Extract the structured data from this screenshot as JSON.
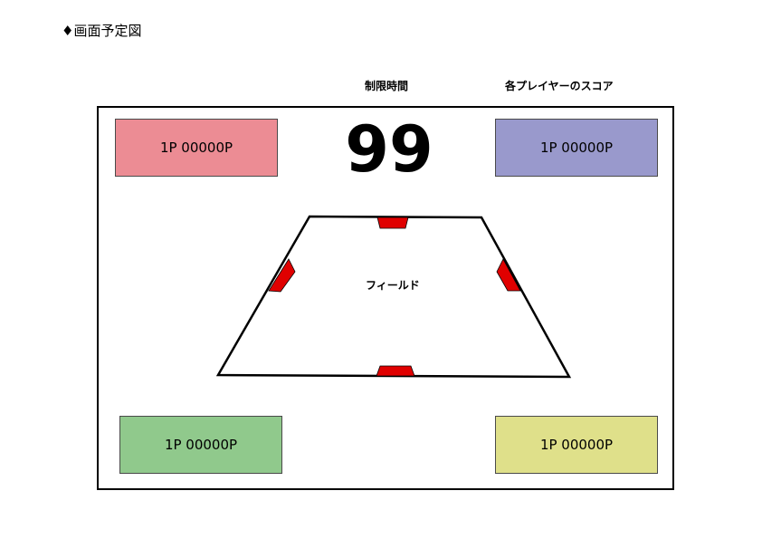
{
  "header": {
    "title": "♦画面予定図"
  },
  "labels": {
    "time_limit": "制限時間",
    "player_scores": "各プレイヤーのスコア"
  },
  "timer": {
    "value": "99"
  },
  "field": {
    "label": "フィールド",
    "outline_color": "#000000",
    "goal_color": "#e00000"
  },
  "scores": {
    "top_left": {
      "text": "1P 00000P",
      "color": "#ec8c94"
    },
    "top_right": {
      "text": "1P 00000P",
      "color": "#9999cc"
    },
    "bottom_left": {
      "text": "1P 00000P",
      "color": "#90c98c"
    },
    "bottom_right": {
      "text": "1P 00000P",
      "color": "#dfe08a"
    }
  }
}
